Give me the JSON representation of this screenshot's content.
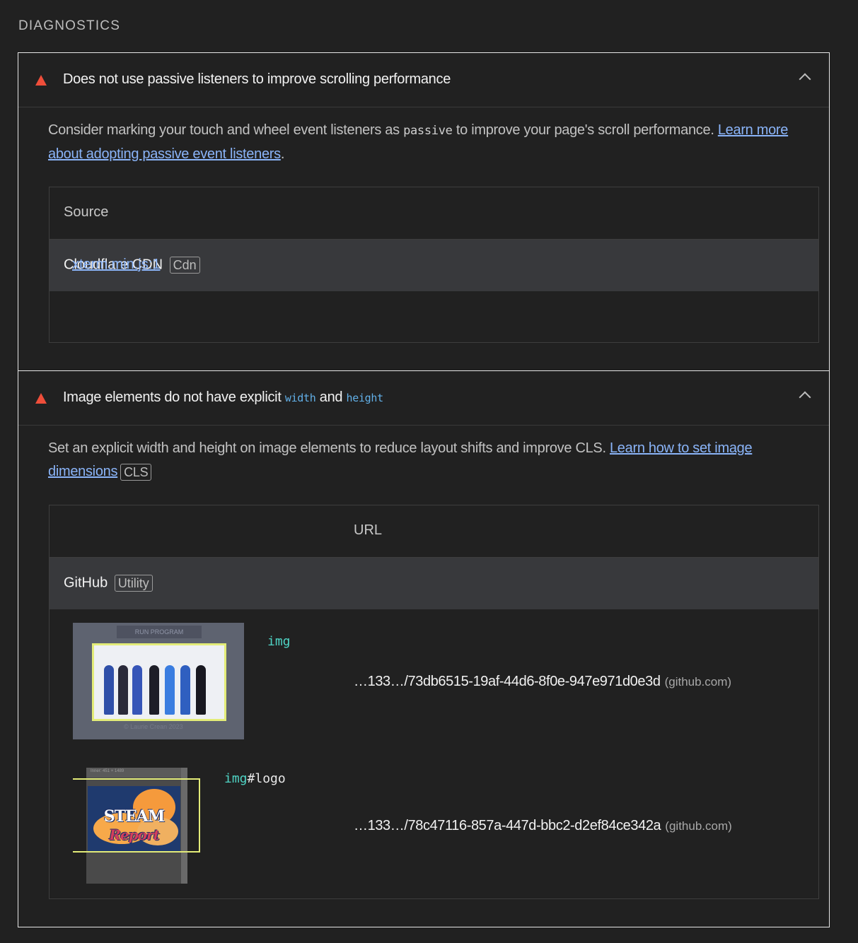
{
  "section": {
    "title": "DIAGNOSTICS"
  },
  "audit1": {
    "title": "Does not use passive listeners to improve scrolling performance",
    "desc_pre": "Consider marking your touch and wheel event listeners as ",
    "desc_code": "passive",
    "desc_post": " to improve your page's scroll performance. ",
    "link": "Learn more about adopting passive event listeners",
    "desc_end": ".",
    "table": {
      "header": "Source",
      "group_name": "Cloudflare CDN",
      "group_tag": "Cdn",
      "row_link": "xterm.min.js:1"
    }
  },
  "audit2": {
    "title_pre": "Image elements do not have explicit ",
    "code1": "width",
    "title_mid": " and ",
    "code2": "height",
    "desc": "Set an explicit width and height on image elements to reduce layout shifts and improve CLS. ",
    "link": "Learn how to set image dimensions",
    "tag": "CLS",
    "table": {
      "header": "URL",
      "group_name": "GitHub",
      "group_tag": "Utility",
      "rows": [
        {
          "selector_tag": "img",
          "selector_rest": "",
          "url": "…133…/73db6515-19af-44d6-8f0e-947e971d0e3d",
          "host": "(github.com)",
          "thumb_label": "RUN PROGRAM",
          "thumb_caption": "© Laurie Crean 2023"
        },
        {
          "selector_tag": "img",
          "selector_rest": "#logo",
          "url": "…133…/78c47116-857a-447d-bbc2-d2ef84ce342a",
          "host": "(github.com)",
          "thumb_label": "Inner: 451 × 1489",
          "logo_main": "STEAM",
          "logo_script": "Report"
        }
      ]
    }
  },
  "colors": {
    "fail": "#ef4e3a",
    "link": "#8ab4f8",
    "highlight": "#e3ec78",
    "code_tag": "#4fd3c4"
  }
}
